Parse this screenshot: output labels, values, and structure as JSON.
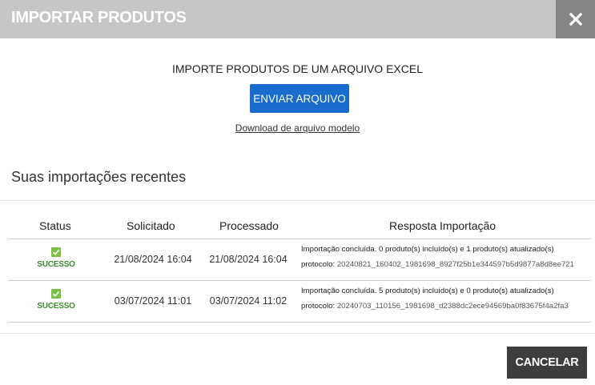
{
  "modal": {
    "title": "IMPORTAR PRODUTOS"
  },
  "import": {
    "heading": "IMPORTE PRODUTOS DE UM ARQUIVO EXCEL",
    "upload_label": "ENVIAR ARQUIVO",
    "template_link": "Download de arquivo modelo"
  },
  "recent": {
    "title": "Suas importações recentes",
    "columns": [
      "Status",
      "Solicitado",
      "Processado",
      "Resposta Importação"
    ],
    "rows": [
      {
        "status": "SUCESSO",
        "requested": "21/08/2024 16:04",
        "processed": "21/08/2024 16:04",
        "response": "Importação concluída. 0 produto(s) incluído(s) e 1 produto(s) atualizado(s)",
        "protocol_label": "protocolo:",
        "protocol": "20240821_160402_1981698_8927f25b1e344597b5d9877a8d8ee721"
      },
      {
        "status": "SUCESSO",
        "requested": "03/07/2024 11:01",
        "processed": "03/07/2024 11:02",
        "response": "Importação concluída. 5 produto(s) incluído(s) e 0 produto(s) atualizado(s)",
        "protocol_label": "protocolo:",
        "protocol": "20240703_110156_1981698_d2388dc2ece94569ba0f83675f4a2fa3"
      }
    ]
  },
  "footer": {
    "cancel_label": "CANCELAR"
  },
  "colors": {
    "header": "#c6c6c6",
    "close": "#858585",
    "primary": "#1a6ccc",
    "success": "#7ac143",
    "cancel": "#3d3d3d"
  },
  "icons": {
    "close": "close-icon",
    "status": "check-icon"
  }
}
